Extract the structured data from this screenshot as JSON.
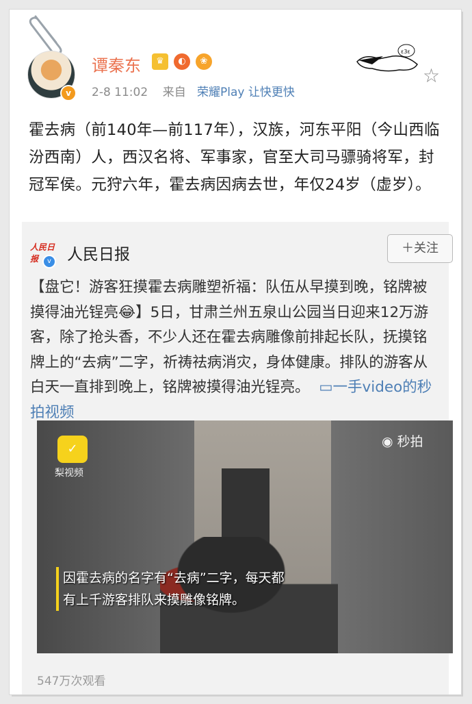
{
  "post": {
    "username": "谭秦东",
    "time": "2-8 11:02",
    "source_prefix": "来自",
    "source": "荣耀Play 让快更快",
    "text": "霍去病（前140年—前117年），汉族，河东平阳（今山西临汾西南）人，西汉名将、军事家，官至大司马骠骑将军，封冠军侯。元狩六年，霍去病因病去世，年仅24岁（虚岁）。"
  },
  "repost": {
    "logo_text": "人民日报",
    "name": "人民日报",
    "follow_label": "＋关注",
    "text": "【盘它！游客狂摸霍去病雕塑祈福：队伍从早摸到晚，铭牌被摸得油光锃亮😂】5日，甘肃兰州五泉山公园当日迎来12万游客，除了抢头香，不少人还在霍去病雕像前排起长队，抚摸铭牌上的“去病”二字，祈祷祛病消灾，身体健康。排队的游客从白天一直排到晚上，铭牌被摸得油光锃亮。",
    "link_text": "一手video的秒拍视频",
    "video": {
      "pear_label": "梨视频",
      "miaopai_label": "秒拍",
      "caption": "因霍去病的名字有“去病”二字，每天都有上千游客排队来摸雕像铭牌。"
    },
    "views": "547万次观看"
  },
  "icons": {
    "star": "star-icon",
    "verify": "verified-icon"
  },
  "colors": {
    "username": "#eb7350",
    "link": "#4e7fb5"
  }
}
